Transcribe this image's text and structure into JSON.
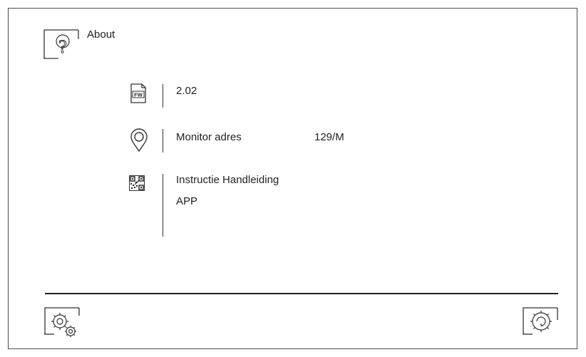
{
  "header": {
    "title": "About",
    "icon": "help-icon"
  },
  "items": {
    "firmware": {
      "icon": "fw-icon",
      "icon_label": "FW",
      "value": "2.02"
    },
    "monitor": {
      "icon": "location-pin-icon",
      "label": "Monitor adres",
      "value": "129/M"
    },
    "manual": {
      "icon": "qr-code-icon",
      "line1": "Instructie Handleiding",
      "line2": "APP"
    }
  },
  "footer": {
    "left_icon": "settings-icon",
    "right_icon": "refresh-settings-icon"
  }
}
